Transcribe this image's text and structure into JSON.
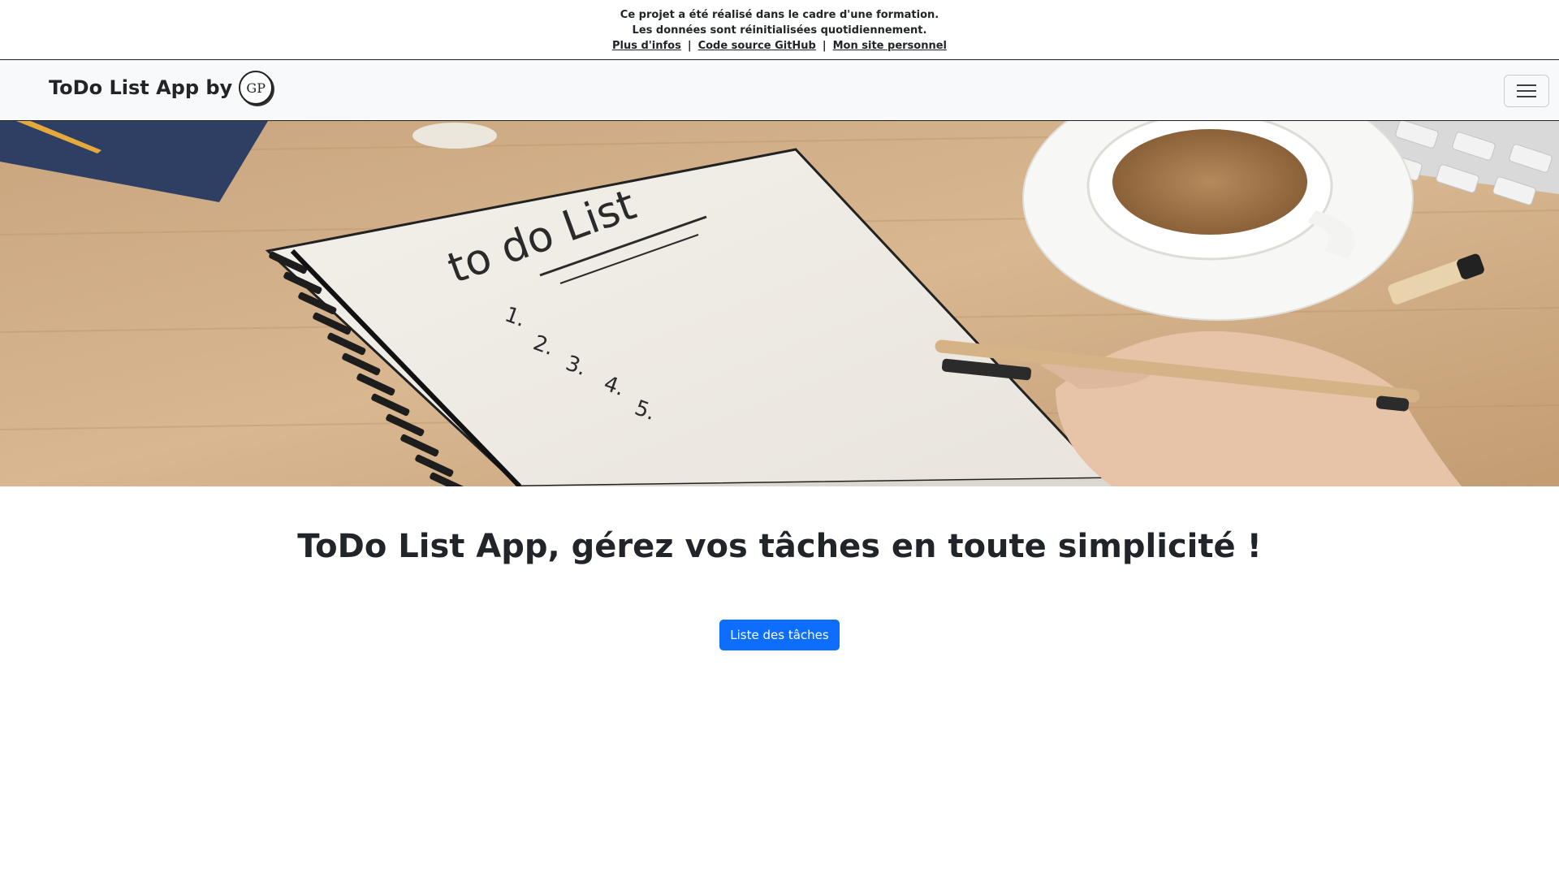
{
  "notice": {
    "line1": "Ce projet a été réalisé dans le cadre d'une formation.",
    "line2": "Les données sont réinitialisées quotidiennement.",
    "links": {
      "info": "Plus d'infos",
      "github": "Code source GitHub",
      "site": "Mon site personnel"
    },
    "separator": "|"
  },
  "navbar": {
    "brand": "ToDo List App by",
    "logo_initials": "GP"
  },
  "hero": {
    "notebook_heading": "to do List",
    "notebook_items": [
      "1.",
      "2.",
      "3.",
      "4.",
      "5."
    ]
  },
  "main": {
    "title": "ToDo List App, gérez vos tâches en toute simplicité !",
    "button_label": "Liste des tâches"
  },
  "colors": {
    "primary": "#0d6efd",
    "navbar_bg": "#f8f9fa",
    "text": "#212529"
  },
  "icons": {
    "toggler": "hamburger-icon"
  }
}
